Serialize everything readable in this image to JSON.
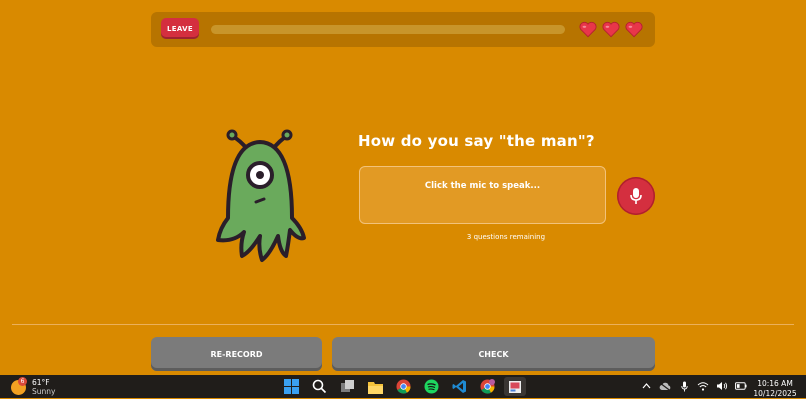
{
  "header": {
    "leave_label": "LEAVE",
    "progress": 0.0,
    "hearts": [
      "heart-icon",
      "heart-icon",
      "heart-icon"
    ]
  },
  "colors": {
    "background": "#d98a00",
    "topbar": "#b77400",
    "accent_red": "#d42f3f",
    "button_gray": "#7b7b7b",
    "alien_green": "#6aaa5c"
  },
  "prompt": {
    "question": "How do you say \"the man\"?",
    "speak_placeholder": "Click the mic to speak...",
    "remaining": "3 questions remaining"
  },
  "actions": {
    "rerecord_label": "RE-RECORD",
    "check_label": "CHECK"
  },
  "taskbar": {
    "weather": {
      "badge": "6",
      "temp": "61°F",
      "condition": "Sunny"
    },
    "apps": [
      "windows-start-icon",
      "search-icon",
      "task-view-icon",
      "file-explorer-icon",
      "chrome-icon",
      "spotify-icon",
      "vscode-icon",
      "chrome-profile-icon",
      "snipping-tool-icon"
    ],
    "clock": {
      "time": "10:16 AM",
      "date": "10/12/2025"
    }
  }
}
